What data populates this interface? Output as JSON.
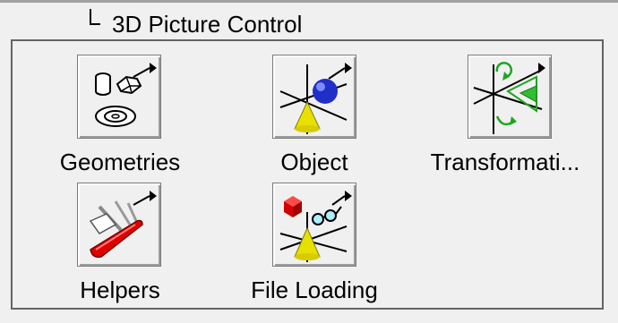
{
  "title": "3D Picture Control",
  "palette": {
    "items": [
      {
        "label": "Geometries",
        "icon": "geometries-icon"
      },
      {
        "label": "Object",
        "icon": "object-icon"
      },
      {
        "label": "Transformati...",
        "icon": "transformations-icon"
      },
      {
        "label": "Helpers",
        "icon": "helpers-icon"
      },
      {
        "label": "File Loading",
        "icon": "file-loading-icon"
      }
    ]
  }
}
